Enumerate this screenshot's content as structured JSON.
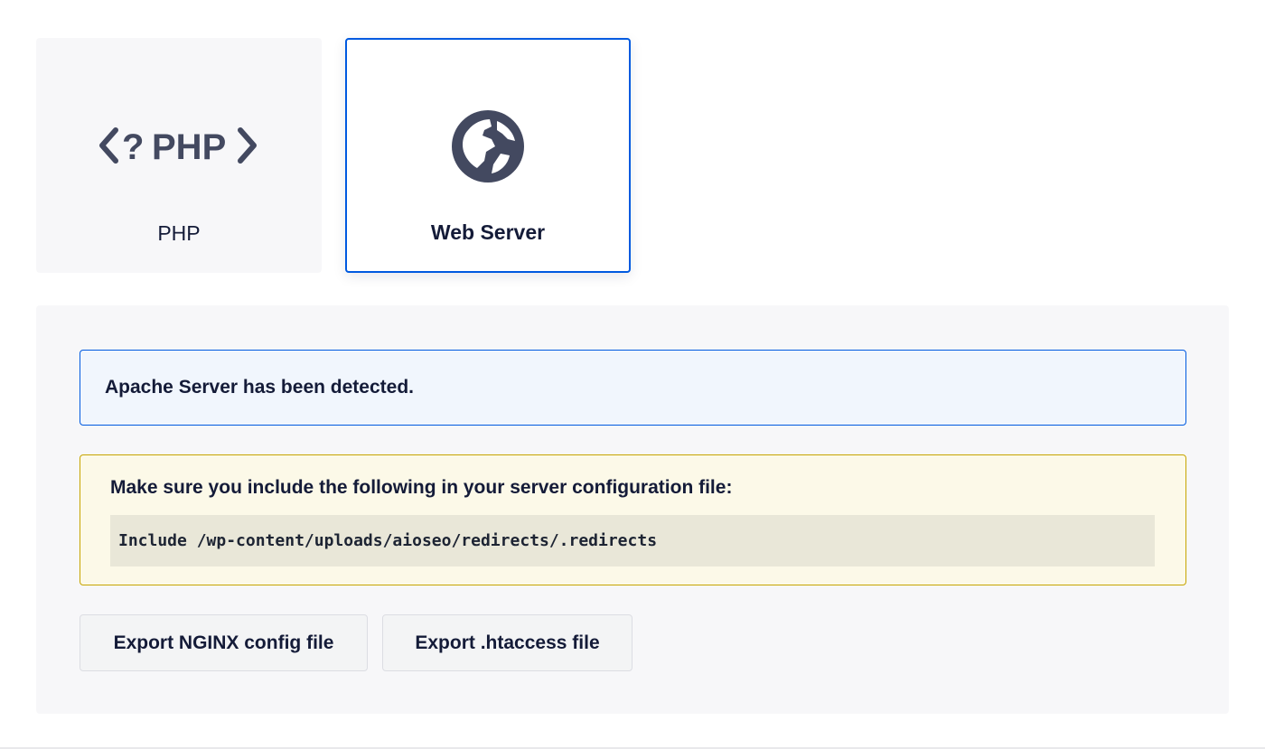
{
  "tabs": [
    {
      "label": "PHP",
      "icon": "php-icon",
      "icon_text": "<?PHP>",
      "selected": false
    },
    {
      "label": "Web Server",
      "icon": "globe-icon",
      "selected": true
    }
  ],
  "notices": {
    "detected": "Apache Server has been detected.",
    "instruction": "Make sure you include the following in your server configuration file:",
    "code": "Include /wp-content/uploads/aioseo/redirects/.redirects"
  },
  "buttons": {
    "export_nginx": "Export NGINX config file",
    "export_htaccess": "Export .htaccess file"
  },
  "colors": {
    "accent": "#005ae0",
    "warning_border": "#c7a500",
    "text": "#141b38",
    "icon": "#434960"
  }
}
